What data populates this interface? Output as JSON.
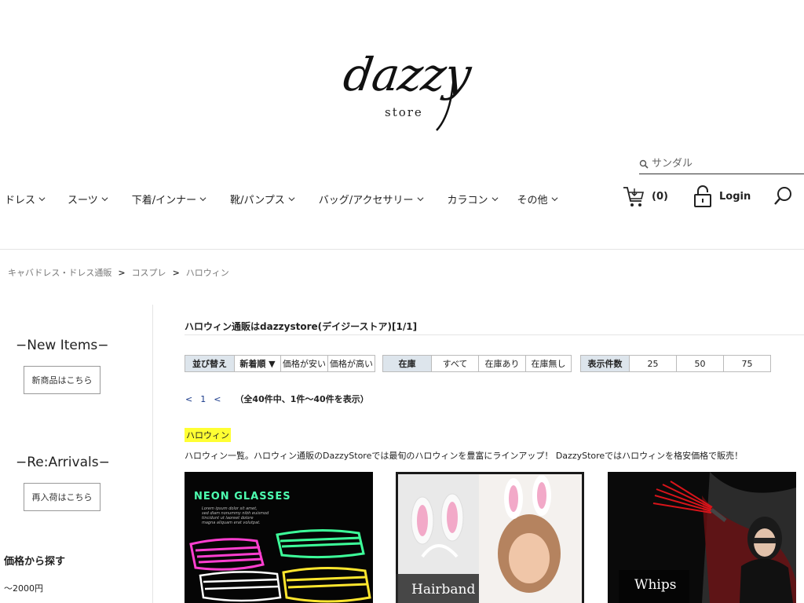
{
  "logo": {
    "script": "dazzy",
    "sub": "store"
  },
  "search": {
    "placeholder": "サンダル"
  },
  "nav": [
    {
      "label": "ドレス"
    },
    {
      "label": "スーツ"
    },
    {
      "label": "下着/インナー"
    },
    {
      "label": "靴/パンプス"
    },
    {
      "label": "バッグ/アクセサリー"
    },
    {
      "label": "カラコン"
    },
    {
      "label": "その他"
    }
  ],
  "cart": {
    "count": "(0)"
  },
  "login": {
    "label": "Login"
  },
  "breadcrumb": [
    {
      "label": "キャバドレス・ドレス通販"
    },
    {
      "label": "コスプレ"
    },
    {
      "label": "ハロウィン"
    }
  ],
  "sidebar": {
    "new_items_title": "−New Items−",
    "new_items_button": "新商品はこちら",
    "rearrivals_title": "−Re:Arrivals−",
    "rearrivals_button": "再入荷はこちら",
    "price_title": "価格から探す",
    "price_items": [
      "〜2000円"
    ]
  },
  "page": {
    "title": "ハロウィン通販はdazzystore(デイジーストア)[1/1]"
  },
  "controls": {
    "sort": {
      "head": "並び替え",
      "options": [
        "新着順 ▼",
        "価格が安い",
        "価格が高い"
      ]
    },
    "stock": {
      "head": "在庫",
      "options": [
        "すべて",
        "在庫あり",
        "在庫無し"
      ]
    },
    "count": {
      "head": "表示件数",
      "options": [
        "25",
        "50",
        "75"
      ]
    }
  },
  "pager": {
    "prev": "<",
    "current": "1",
    "next": "<",
    "summary": "（全40件中、1件〜40件を表示）"
  },
  "category": {
    "tag": "ハロウィン",
    "description": "ハロウィン一覧。ハロウィン通販のDazzyStoreでは最旬のハロウィンを豊富にラインアップ！ DazzyStoreではハロウィンを格安価格で販売！"
  },
  "products": [
    {
      "banner": "NEON GLASSES",
      "caption": [
        "Lorem ipsum dolor sit amet,",
        "sed diam nonummy nibh euismod",
        "tincidunt ut laoreet dolore",
        "magna aliquam erat volutpat."
      ]
    },
    {
      "banner": "Hairband"
    },
    {
      "banner": "Whips"
    }
  ],
  "colors": {
    "highlight": "#ffff33",
    "table_head": "#dde5ec",
    "link": "#1a3a8a"
  }
}
